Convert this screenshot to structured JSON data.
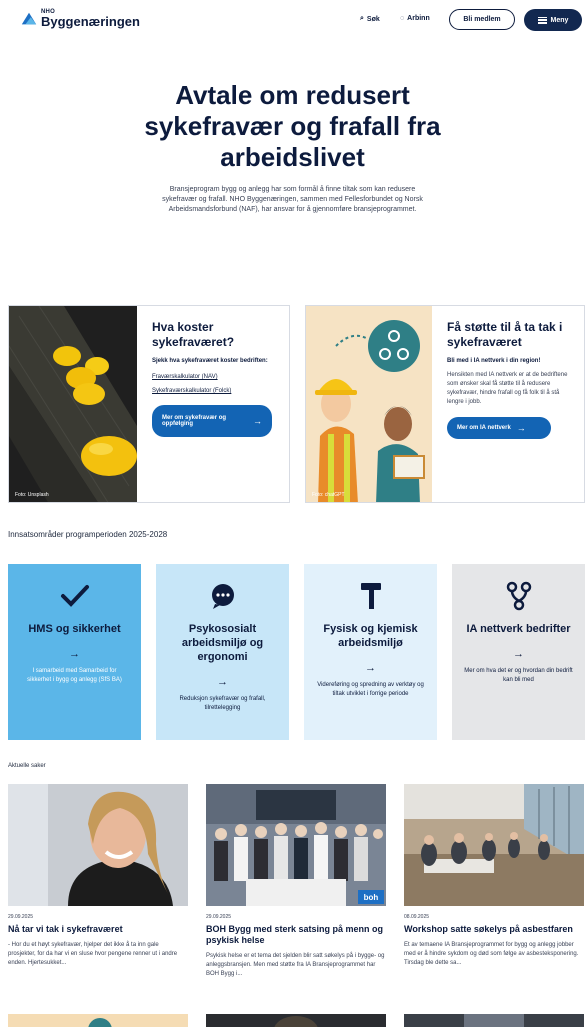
{
  "header": {
    "logo_small": "NHO",
    "logo_big": "Byggenæringen",
    "search_label": "Søk",
    "login_label": "Arbinn",
    "member_label": "Bli medlem",
    "menu_label": "Meny"
  },
  "hero": {
    "title": "Avtale om redusert sykefravær og frafall fra arbeidslivet",
    "intro": "Bransjeprogram bygg og anlegg har som formål å finne tiltak som kan redusere sykefravær og frafall. NHO Byggenæringen, sammen med Fellesforbundet og Norsk Arbeidsmandsforbund (NAF), har ansvar for å gjennomføre bransjeprogrammet."
  },
  "cards": [
    {
      "title": "Hva koster sykefraværet?",
      "lead": "Sjekk hva sykefraværet koster bedriften:",
      "links": [
        "Fraværskalkulator (NAV)",
        "Sykefraværskalkulator (Folck)"
      ],
      "button": "Mer om sykefravær og oppfølging",
      "credit": "Foto: Unsplash"
    },
    {
      "title": "Få støtte til å ta tak i sykefraværet",
      "lead": "Bli med i IA nettverk i din region!",
      "text": "Hensikten med IA nettverk er at de bedriftene som ønsker skal få støtte til å redusere sykefravær, hindre frafall og få folk til å stå lengre i jobb.",
      "button": "Mer om IA nettverk",
      "credit": "Foto: chatGPT"
    }
  ],
  "focus": {
    "heading": "Innsatsområder programperioden 2025-2028",
    "tiles": [
      {
        "title": "HMS og sikkerhet",
        "text": "I samarbeid med Samarbeid for sikkerhet i bygg og anlegg (SfS BA)",
        "bg": "#5bb6e8",
        "icon": "checkmark-icon"
      },
      {
        "title": "Psykososialt arbeidsmiljø og ergonomi",
        "text": "Reduksjon sykefravær og frafall, tilrettelegging",
        "bg": "#c7e6f8",
        "icon": "chat-bubble-icon"
      },
      {
        "title": "Fysisk og kjemisk arbeidsmiljø",
        "text": "Videreføring og spredning av verktøy og tiltak utviklet i forrige periode",
        "bg": "#e2f1fb",
        "icon": "hammer-icon"
      },
      {
        "title": "IA nettverk bedrifter",
        "text": "Mer om hva det er og hvordan din bedrift kan bli med",
        "bg": "#e5e6e8",
        "icon": "network-icon"
      }
    ]
  },
  "news": {
    "heading": "Aktuelle saker",
    "items": [
      {
        "date": "29.09.2025",
        "title": "Nå tar vi tak i sykefraværet",
        "text": "- Hor du et høyt sykefravær, hjelper det ikke å ta inn gale prosjekter, for da har vi en sluse hvor pengene renner ut i andre enden. Hjertesukket..."
      },
      {
        "date": "29.09.2025",
        "title": "BOH Bygg med sterk satsing på menn og psykisk helse",
        "text": "Psykisk helse er et tema det sjelden blir satt søkelys på i bygge- og anleggsbransjen. Men med støtte fra IA Bransjeprogrammet har BOH Bygg i...",
        "badge": "boh"
      },
      {
        "date": "08.09.2025",
        "title": "Workshop satte søkelys på asbestfaren",
        "text": "Et av temaene IA Bransjeprogrammet for bygg og anlegg jobber med er å hindre sykdom og død som følge av asbesteksponering. Tirsdag ble dette sa..."
      }
    ]
  }
}
